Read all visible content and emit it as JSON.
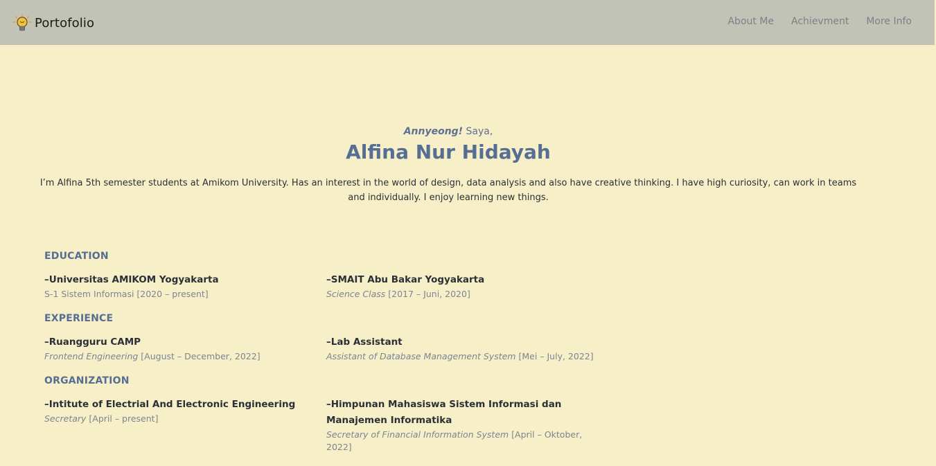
{
  "header": {
    "brand": "Portofolio",
    "brand_icon": "lightbulb-icon",
    "nav": [
      "About Me",
      "Achievment",
      "More Info"
    ]
  },
  "hero": {
    "greeting_em": "Annyeong!",
    "greeting_rest": " Saya,",
    "name": "Alfina Nur Hidayah",
    "bio": "I’m Alfina 5th semester students at Amikom University. Has an interest in the world of design, data analysis and also have creative thinking. I have high curiosity, can work in teams and individually. I enjoy learning new things."
  },
  "education": {
    "title": "EDUCATION",
    "items": [
      {
        "title": "–Universitas AMIKOM Yogyakarta",
        "role": "",
        "period": "S-1 Sistem Informasi [2020 – present]"
      },
      {
        "title": "–SMAIT Abu Bakar Yogyakarta",
        "role": "Science Class",
        "period": " [2017 – Juni, 2020]"
      }
    ]
  },
  "experience": {
    "title": "EXPERIENCE",
    "items": [
      {
        "title": "–Ruangguru CAMP",
        "role": "Frontend Engineering",
        "period": " [August – December, 2022]"
      },
      {
        "title": "–Lab Assistant",
        "role": "Assistant of Database Management System",
        "period": " [Mei – July, 2022]"
      }
    ]
  },
  "organization": {
    "title": "ORGANIZATION",
    "items": [
      {
        "title": "–Intitute of Electrial And Electronic Engineering",
        "role": "Secretary",
        "period": " [April – present]"
      },
      {
        "title": "–Himpunan Mahasiswa Sistem Informasi dan Manajemen Informatika",
        "role": "Secretary of Financial Information System",
        "period": " [April – Oktober, 2022]"
      }
    ]
  },
  "colors": {
    "background": "#f7efc7",
    "navbar": "#c0c3b6",
    "accent": "#566e93",
    "muted": "#7b8592"
  }
}
